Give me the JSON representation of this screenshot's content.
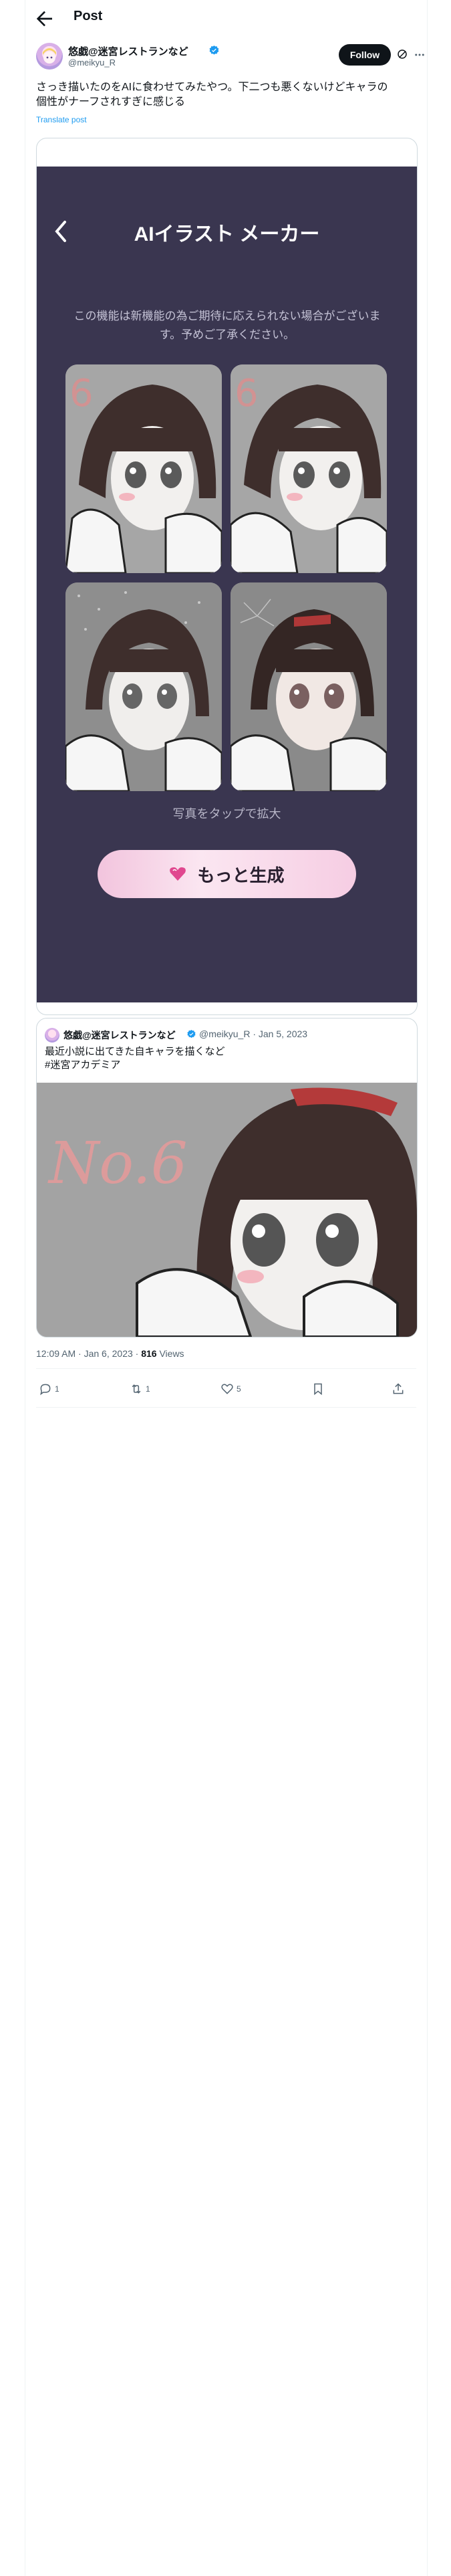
{
  "header": {
    "title": "Post"
  },
  "author": {
    "display_name": "悠戯@迷宮レストランなど",
    "handle": "@meikyu_R",
    "follow_label": "Follow"
  },
  "post": {
    "text": "さっき描いたのをAIに食わせてみたやつ。下二つも悪くないけどキャラの\n個性がナーフされすぎに感じる",
    "translate_label": "Translate post"
  },
  "app_screen": {
    "title": "AIイラスト メーカー",
    "notice": "この機能は新機能の為ご期待に応えられない場合がございま\nす。予めご了承ください。",
    "tap_hint": "写真をタップで拡大",
    "generate_label": "もっと生成",
    "thumbnail_labels": [
      "6",
      "6"
    ]
  },
  "quote": {
    "display_name": "悠戯@迷宮レストランなど",
    "meta": "@meikyu_R · Jan 5, 2023",
    "text": "最近小説に出てきた自キャラを描くなど\n#迷宮アカデミア",
    "image_label": "No.6"
  },
  "meta": {
    "time": "12:09 AM · Jan 6, 2023 · ",
    "views_count": "816",
    "views_label": " Views"
  },
  "actions": {
    "replies": "1",
    "reposts": "1",
    "likes": "5"
  },
  "colors": {
    "accent": "#1d9bf0",
    "app_background": "#3a3650",
    "button_pink": "#f6cde3"
  }
}
